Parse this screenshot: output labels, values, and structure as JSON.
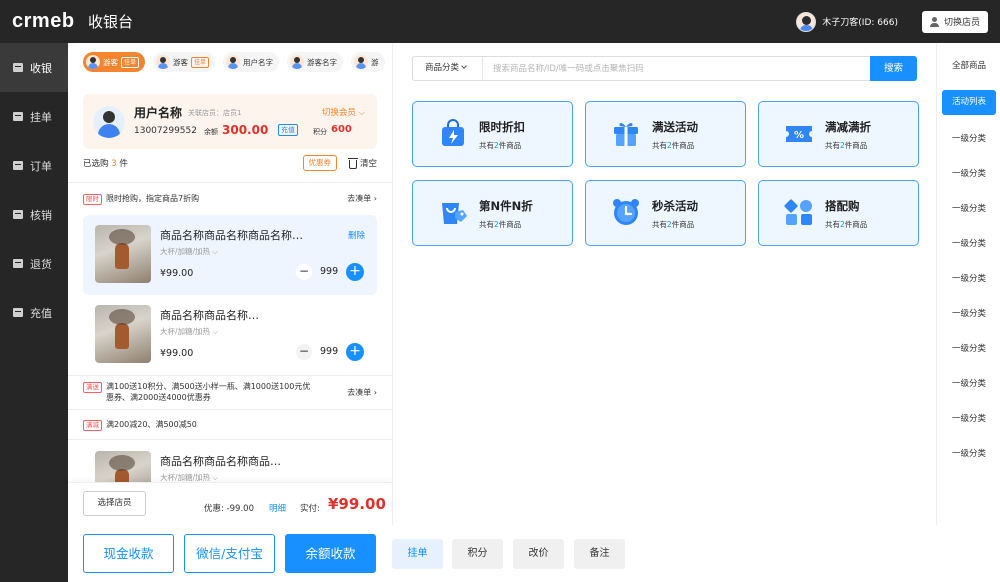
{
  "header": {
    "logo": "crmeb",
    "title": "收银台",
    "user_name": "木子刀客(ID: 666)",
    "switch_staff": "切换店员"
  },
  "leftnav": [
    {
      "label": "收银",
      "active": true
    },
    {
      "label": "挂单"
    },
    {
      "label": "订单"
    },
    {
      "label": "核销"
    },
    {
      "label": "退货"
    },
    {
      "label": "充值"
    }
  ],
  "guest_tabs": [
    {
      "label": "游客",
      "tag": "挂单",
      "active": true
    },
    {
      "label": "游客",
      "tag": "挂单"
    },
    {
      "label": "用户名字"
    },
    {
      "label": "游客名字"
    },
    {
      "label": "游"
    }
  ],
  "member": {
    "name": "用户名称",
    "store": "关联店员：店员1",
    "switch": "切换会员",
    "phone": "13007299552",
    "balance_label": "余额",
    "balance": "300.00",
    "recharge": "充值",
    "points_label": "积分",
    "points": "600"
  },
  "cart": {
    "selected_prefix": "已选购",
    "selected_count": "3",
    "selected_suffix": "件",
    "coupon": "优惠券",
    "clear": "清空",
    "promo1": {
      "tag": "限时",
      "text": "限时抢购，指定商品7折购",
      "link": "去凑单 ›"
    },
    "items": [
      {
        "name": "商品名称商品名称商品名称…",
        "spec": "大杯/加糖/加热 ⌵",
        "price": "¥99.00",
        "qty": "999",
        "delete": "删除"
      },
      {
        "name": "商品名称商品名称…",
        "spec": "大杯/加糖/加热 ⌵",
        "price": "¥99.00",
        "qty": "999"
      },
      {
        "name": "商品名称商品名称商品…",
        "spec": "大杯/加糖/加热 ⌵"
      }
    ],
    "promo2": {
      "tag": "满送",
      "text": "满100送10积分、满500送小样一瓶、满1000送100元优惠券、满2000送4000优惠券",
      "link": "去凑单 ›"
    },
    "promo3": {
      "tag": "满减",
      "text": "满200减20、满500减50"
    }
  },
  "footer": {
    "select_store": "选择店员",
    "discount_label": "优惠:",
    "discount": "-99.00",
    "detail": "明细",
    "paid_label": "实付:",
    "paid": "¥99.00"
  },
  "pay": {
    "cash": "现金收款",
    "wechat": "微信/支付宝",
    "balance": "余额收款",
    "hang": "挂单",
    "points": "积分",
    "reprice": "改价",
    "remark": "备注"
  },
  "search": {
    "category": "商品分类",
    "placeholder": "搜索商品名称/ID/唯一码或点击聚焦扫码",
    "button": "搜索"
  },
  "promotions": [
    {
      "title": "限时折扣",
      "pre": "共有",
      "num": "2",
      "post": "件商品",
      "icon": "flash-bag-icon"
    },
    {
      "title": "满送活动",
      "pre": "共有",
      "num": "2",
      "post": "件商品",
      "icon": "gift-icon"
    },
    {
      "title": "满减满折",
      "pre": "共有",
      "num": "2",
      "post": "件商品",
      "icon": "discount-ticket-icon"
    },
    {
      "title": "第N件N折",
      "pre": "共有",
      "num": "2",
      "post": "件商品",
      "icon": "tag-bag-icon"
    },
    {
      "title": "秒杀活动",
      "pre": "共有",
      "num": "2",
      "post": "件商品",
      "icon": "alarm-clock-icon"
    },
    {
      "title": "搭配购",
      "pre": "共有",
      "num": "2",
      "post": "件商品",
      "icon": "blocks-icon"
    }
  ],
  "categories": [
    {
      "label": "全部商品"
    },
    {
      "label": "活动列表",
      "active": true
    },
    {
      "label": "一级分类"
    },
    {
      "label": "一级分类"
    },
    {
      "label": "一级分类"
    },
    {
      "label": "一级分类"
    },
    {
      "label": "一级分类"
    },
    {
      "label": "一级分类"
    },
    {
      "label": "一级分类"
    },
    {
      "label": "一级分类"
    },
    {
      "label": "一级分类"
    },
    {
      "label": "一级分类"
    }
  ],
  "colors": {
    "accent": "#1890ff",
    "orange": "#f5842e",
    "price_red": "#e0322b",
    "dark": "#262626"
  }
}
